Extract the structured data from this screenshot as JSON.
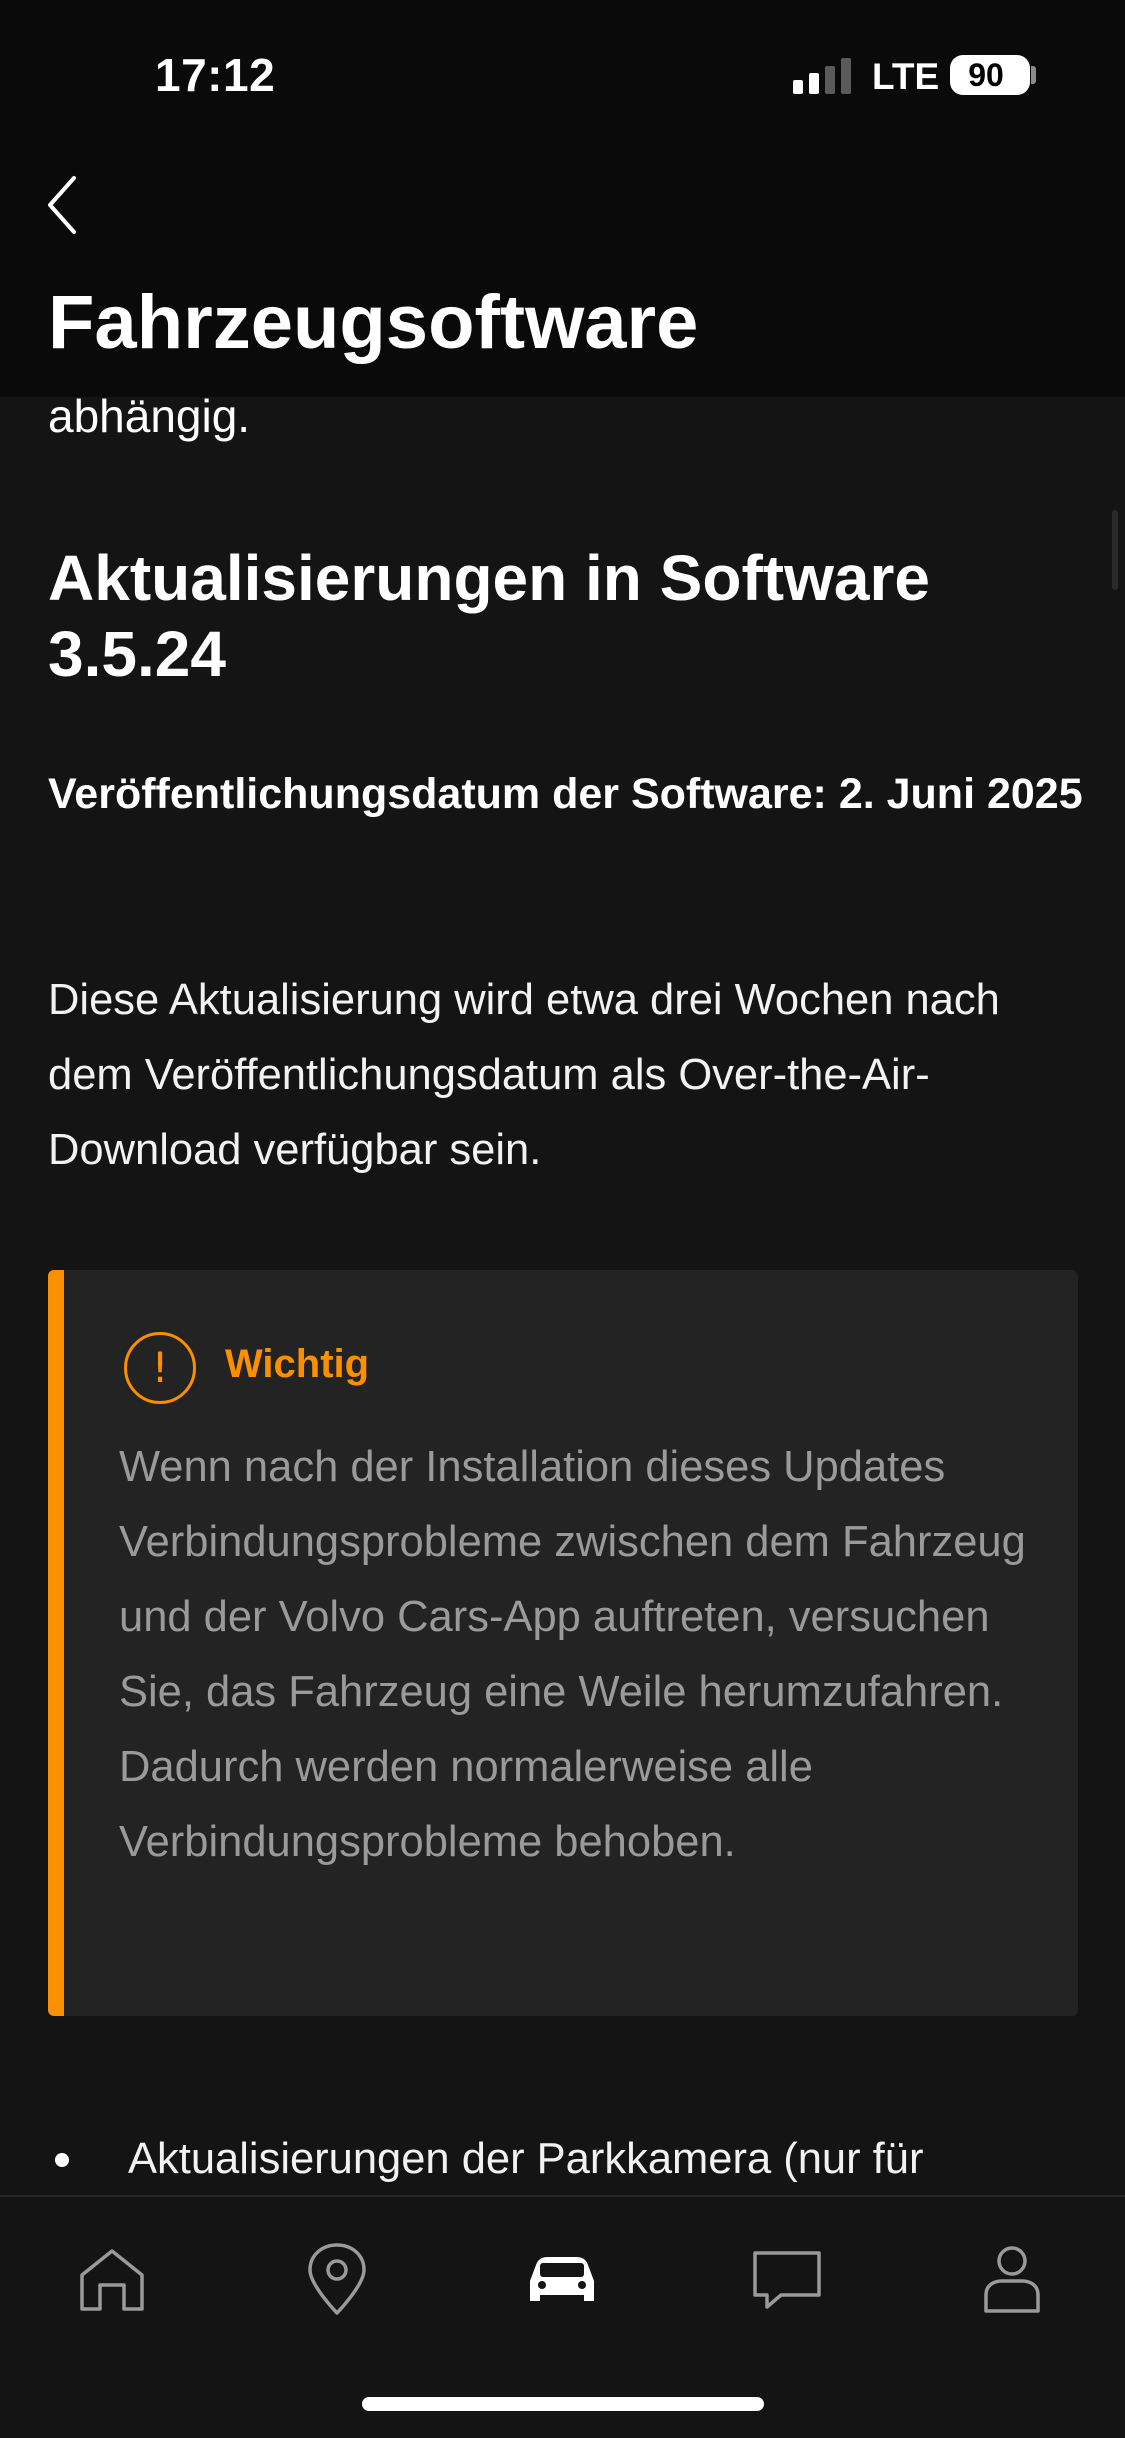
{
  "status_bar": {
    "time": "17:12",
    "network": "LTE",
    "battery": "90"
  },
  "header": {
    "back_icon": "chevron-left-icon",
    "title": "Fahrzeugsoftware"
  },
  "content": {
    "previous_fragment": "abhängig.",
    "section_title": "Aktualisierungen in Software 3.5.24",
    "release_date": "Veröffentlichungsdatum der Software: 2. Juni 2025",
    "availability_text": "Diese Aktualisierung wird etwa drei Wochen nach dem Veröffentlichungsdatum als Over-the-Air-Download verfügbar sein.",
    "notice": {
      "icon": "exclamation-circle-icon",
      "icon_glyph": "!",
      "label": "Wichtig",
      "text": "Wenn nach der Installation dieses Updates Verbindungsprobleme zwischen dem Fahrzeug und der Volvo Cars-App auftreten, versuchen Sie, das Fahrzeug eine Weile herumzufahren. Dadurch werden normalerweise alle Verbindungsprobleme behoben.",
      "accent_color": "#fa8f00"
    },
    "bullets": [
      "Aktualisierungen der Parkkamera (nur für"
    ]
  },
  "tab_bar": {
    "items": [
      {
        "icon": "home-icon"
      },
      {
        "icon": "location-pin-icon"
      },
      {
        "icon": "car-icon",
        "active": true
      },
      {
        "icon": "chat-bubble-icon"
      },
      {
        "icon": "profile-icon"
      }
    ]
  }
}
